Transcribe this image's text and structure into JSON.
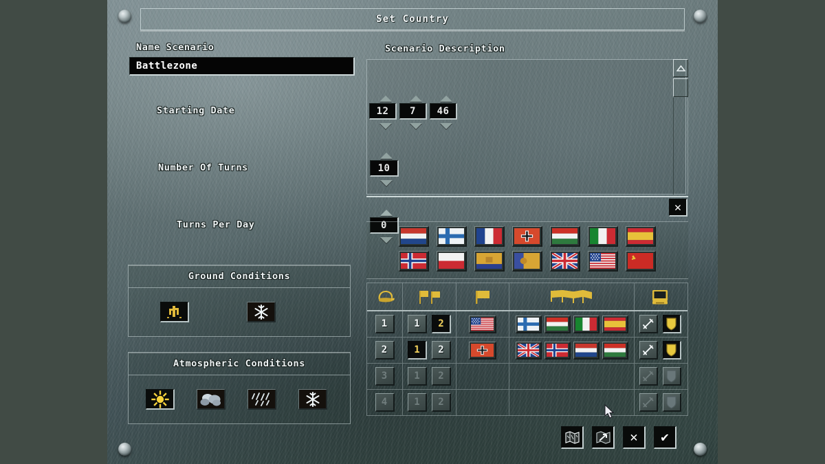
{
  "window": {
    "title": "Set Country"
  },
  "left_panel": {
    "name_scenario": {
      "label": "Name Scenario",
      "value": "Battlezone"
    },
    "starting_date": {
      "label": "Starting Date",
      "month": "12",
      "day": "7",
      "year": "46"
    },
    "number_of_turns": {
      "label": "Number Of Turns",
      "value": "10"
    },
    "turns_per_day": {
      "label": "Turns Per Day",
      "value": "0"
    },
    "ground_conditions": {
      "label": "Ground Conditions",
      "options": [
        {
          "name": "dry-icon",
          "selected": true
        },
        {
          "name": "frozen-icon",
          "selected": false
        }
      ]
    },
    "atmospheric_conditions": {
      "label": "Atmospheric Conditions",
      "options": [
        {
          "name": "sun-icon",
          "selected": true
        },
        {
          "name": "cloud-icon",
          "selected": false
        },
        {
          "name": "rain-icon",
          "selected": false
        },
        {
          "name": "snow-icon",
          "selected": false
        }
      ]
    }
  },
  "right_panel": {
    "description": {
      "label": "Scenario Description",
      "text": ""
    },
    "scrollbar": {
      "up_icon": "triangle-up-icon"
    },
    "clear_description_button": {
      "icon": "x-icon",
      "label": "✕"
    },
    "flag_palette": {
      "row1": [
        "netherlands",
        "finland",
        "france",
        "germany",
        "hungary",
        "italy",
        "spain"
      ],
      "row2": [
        "norway",
        "poland",
        "romania",
        "portugal",
        "united-kingdom",
        "united-states",
        "soviet-union"
      ]
    },
    "country_table": {
      "headers": [
        {
          "name": "side-helmet-icon",
          "title": "Side"
        },
        {
          "name": "team-flags-icon",
          "title": "Team"
        },
        {
          "name": "main-flag-icon",
          "title": "Main Country"
        },
        {
          "name": "allied-flags-icon",
          "title": "Allies"
        },
        {
          "name": "computer-ai-icon",
          "title": "Computer"
        }
      ],
      "rows": [
        {
          "side": "1",
          "team": [
            {
              "label": "1",
              "selected": false,
              "enabled": true
            },
            {
              "label": "2",
              "selected": true,
              "enabled": true
            }
          ],
          "main_country": "united-states",
          "allies": [
            "finland",
            "hungary",
            "italy",
            "spain"
          ],
          "ai": [
            {
              "name": "sword-icon",
              "active": true
            },
            {
              "name": "shield-icon",
              "active": true
            }
          ]
        },
        {
          "side": "2",
          "team": [
            {
              "label": "1",
              "selected": true,
              "enabled": true
            },
            {
              "label": "2",
              "selected": false,
              "enabled": true
            }
          ],
          "main_country": "germany",
          "allies": [
            "united-kingdom",
            "norway",
            "netherlands",
            "hungary"
          ],
          "ai": [
            {
              "name": "sword-icon",
              "active": true
            },
            {
              "name": "shield-icon",
              "active": true
            }
          ]
        },
        {
          "side": "3",
          "team": [
            {
              "label": "1",
              "selected": false,
              "enabled": false
            },
            {
              "label": "2",
              "selected": false,
              "enabled": false
            }
          ],
          "main_country": "",
          "allies": [],
          "ai": [
            {
              "name": "sword-icon",
              "active": false
            },
            {
              "name": "shield-icon",
              "active": false
            }
          ]
        },
        {
          "side": "4",
          "team": [
            {
              "label": "1",
              "selected": false,
              "enabled": false
            },
            {
              "label": "2",
              "selected": false,
              "enabled": false
            }
          ],
          "main_country": "",
          "allies": [],
          "ai": [
            {
              "name": "sword-icon",
              "active": false
            },
            {
              "name": "shield-icon",
              "active": false
            }
          ]
        }
      ]
    }
  },
  "action_bar": [
    {
      "name": "map-button",
      "icon": "map-icon"
    },
    {
      "name": "load-map-button",
      "icon": "map-arrow-icon"
    },
    {
      "name": "cancel-button",
      "icon": "x-icon",
      "label": "✕"
    },
    {
      "name": "confirm-button",
      "icon": "check-icon",
      "label": "✔"
    }
  ],
  "colors": {
    "panel_base": "#56676a",
    "margin": "#414b45",
    "field_bg": "#050505",
    "text": "#eef3f4",
    "gold": "#f5d25a",
    "bevel_light": "#cfdadb",
    "bevel_dark": "#1d2524"
  }
}
